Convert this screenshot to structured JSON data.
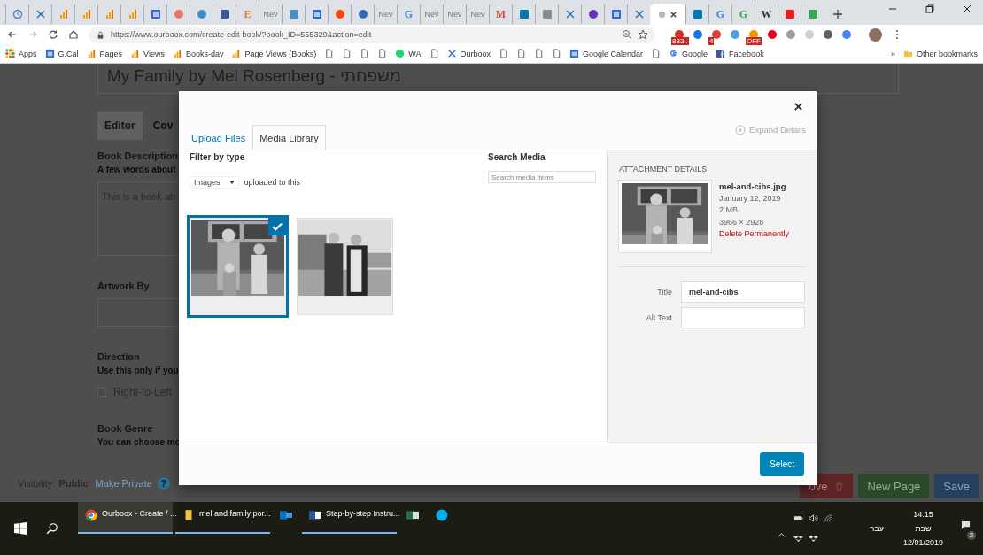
{
  "browser": {
    "tabs": [
      {
        "kind": "clock",
        "selected": false
      },
      {
        "kind": "x",
        "selected": false
      },
      {
        "kind": "bars",
        "selected": false
      },
      {
        "kind": "bars",
        "selected": false
      },
      {
        "kind": "bars",
        "selected": false
      },
      {
        "kind": "bars",
        "selected": false
      },
      {
        "kind": "cal",
        "selected": false
      },
      {
        "kind": "round",
        "color": "#e8756a",
        "selected": false
      },
      {
        "kind": "round",
        "color": "#3b8fd1",
        "selected": false
      },
      {
        "kind": "square",
        "color": "#3b5998",
        "selected": false
      },
      {
        "kind": "letter",
        "label": "E",
        "color": "#e07b39",
        "selected": false
      },
      {
        "kind": "text",
        "label": "Nev",
        "selected": false
      },
      {
        "kind": "square",
        "color": "#4a90c8",
        "selected": false
      },
      {
        "kind": "cal",
        "selected": false
      },
      {
        "kind": "round",
        "color": "#ff4500",
        "selected": false
      },
      {
        "kind": "round",
        "color": "#2a6ebb",
        "selected": false
      },
      {
        "kind": "text",
        "label": "Nev",
        "selected": false
      },
      {
        "kind": "letter",
        "label": "G",
        "color": "#4285f4",
        "selected": false
      },
      {
        "kind": "text",
        "label": "Nev",
        "selected": false
      },
      {
        "kind": "text",
        "label": "Nev",
        "selected": false
      },
      {
        "kind": "text",
        "label": "Nev",
        "selected": false
      },
      {
        "kind": "letter",
        "label": "M",
        "color": "#d44638",
        "selected": false
      },
      {
        "kind": "square",
        "color": "#0077b5",
        "selected": false
      },
      {
        "kind": "square",
        "color": "#8a8a8a",
        "selected": false
      },
      {
        "kind": "x",
        "selected": false
      },
      {
        "kind": "round",
        "color": "#6b2fbf",
        "selected": false
      },
      {
        "kind": "cal",
        "selected": false
      },
      {
        "kind": "x",
        "selected": false
      },
      {
        "kind": "round",
        "color": "#b8bcc0",
        "selected": true
      },
      {
        "kind": "square",
        "color": "#0077b5",
        "selected": false
      },
      {
        "kind": "letter",
        "label": "G",
        "color": "#4285f4",
        "selected": false
      },
      {
        "kind": "letter",
        "label": "G",
        "color": "#34a853",
        "selected": false
      },
      {
        "kind": "letter",
        "label": "W",
        "color": "#333333",
        "selected": false
      },
      {
        "kind": "square",
        "color": "#e62117",
        "selected": false
      },
      {
        "kind": "square",
        "color": "#34a853",
        "selected": false
      }
    ],
    "url": "https://www.ourboox.com/create-edit-book/?book_ID=555329&action=edit",
    "extensions": [
      {
        "color": "#d93025",
        "badge": "883.."
      },
      {
        "color": "#1a73e8"
      },
      {
        "color": "#e53935",
        "badge": "4"
      },
      {
        "color": "#4aa3df"
      },
      {
        "color": "#f29900",
        "badge": "OFF"
      },
      {
        "color": "#e60023"
      },
      {
        "color": "#9e9e9e"
      },
      {
        "color": "#d0d0d0"
      },
      {
        "color": "#5f6368"
      },
      {
        "color": "#4285f4"
      }
    ],
    "bookmarks": [
      {
        "kind": "apps",
        "label": "Apps"
      },
      {
        "kind": "cal",
        "label": "G.Cal"
      },
      {
        "kind": "bars",
        "label": "Pages"
      },
      {
        "kind": "bars",
        "label": "Views"
      },
      {
        "kind": "bars",
        "label": "Books-day"
      },
      {
        "kind": "bars",
        "label": "Page Views (Books)"
      },
      {
        "kind": "doc"
      },
      {
        "kind": "doc"
      },
      {
        "kind": "doc"
      },
      {
        "kind": "doc"
      },
      {
        "kind": "chat",
        "label": "WA"
      },
      {
        "kind": "doc"
      },
      {
        "kind": "x",
        "label": "Ourboox"
      },
      {
        "kind": "doc"
      },
      {
        "kind": "doc"
      },
      {
        "kind": "doc"
      },
      {
        "kind": "doc"
      },
      {
        "kind": "cal",
        "label": "Google Calendar"
      },
      {
        "kind": "doc"
      },
      {
        "kind": "google",
        "label": "Google"
      },
      {
        "kind": "facebook",
        "label": "Facebook"
      }
    ],
    "overflow": "»",
    "other_bookmarks": "Other bookmarks"
  },
  "page": {
    "title_value": "My Family by Mel Rosenberg - משפחתי",
    "tabs": [
      {
        "label": "Editor",
        "selected": false
      },
      {
        "label": "Cov",
        "selected": true
      }
    ],
    "description_label": "Book Description",
    "description_hint": "A few words about",
    "description_value": "This is a book ab",
    "artwork_label": "Artwork By",
    "direction_label": "Direction",
    "direction_hint": "Use this only if you",
    "rtl": {
      "label": "Right-to-Left",
      "checked": false
    },
    "genre_label": "Book Genre",
    "genre_hint": "You can choose mo",
    "visibility_label": "Visibility:",
    "visibility_value": "Public",
    "make_private": "Make Private",
    "help": "?",
    "buttons": {
      "remove": "ove",
      "new_page": "New Page",
      "save": "Save"
    }
  },
  "modal": {
    "tabs": [
      {
        "label": "Upload Files",
        "selected": false
      },
      {
        "label": "Media Library",
        "selected": true
      }
    ],
    "expand_details": "Expand Details",
    "filter_label": "Filter by type",
    "filter_value": "Images",
    "filter_suffix": "uploaded to this",
    "search_label": "Search Media",
    "search_placeholder": "Search media items",
    "items": [
      {
        "kind": "picture",
        "selected": true
      },
      {
        "kind": "picture",
        "selected": false
      }
    ],
    "details": {
      "heading": "ATTACHMENT DETAILS",
      "filename": "mel-and-cibs.jpg",
      "date": "January 12, 2019",
      "size": "2 MB",
      "dimensions": "3966 × 2928",
      "delete": "Delete Permanently",
      "title_label": "Title",
      "title_value": "mel-and-cibs",
      "alt_label": "Alt Text"
    },
    "select": "Select"
  },
  "taskbar": {
    "tasks": [
      {
        "kind": "chrome",
        "label": "Ourboox - Create / ...",
        "open": true,
        "selected": true
      },
      {
        "kind": "folder",
        "label": "mel and family  por...",
        "open": true,
        "selected": false
      },
      {
        "kind": "outlook",
        "open": false,
        "selected": false
      },
      {
        "kind": "word",
        "label": "Step-by-step Instru...",
        "open": true,
        "selected": false
      },
      {
        "kind": "excel",
        "open": false,
        "selected": false
      },
      {
        "kind": "skype",
        "open": false,
        "selected": false
      }
    ],
    "language": "עבר",
    "time": "14:15",
    "day": "שבת",
    "date": "12/01/2019",
    "notifications": "2"
  }
}
